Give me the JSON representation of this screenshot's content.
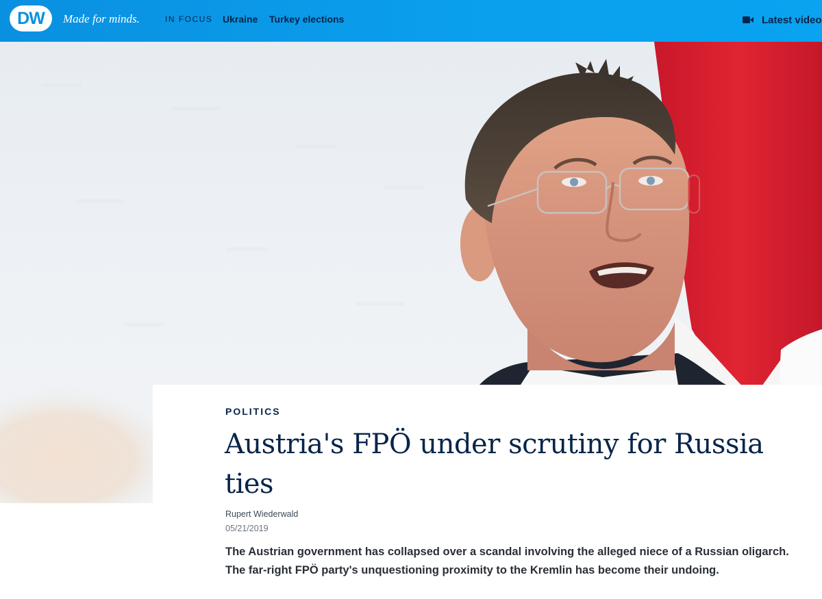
{
  "header": {
    "logo_text": "DW",
    "tagline": "Made for minds.",
    "in_focus_label": "IN FOCUS",
    "nav_links": [
      "Ukraine",
      "Turkey elections"
    ],
    "latest_label": "Latest video"
  },
  "hero": {
    "icon": "portrait-photo",
    "flag_colors": [
      "#d81e2c",
      "#ffffff"
    ]
  },
  "article": {
    "category": "POLITICS",
    "headline": "Austria's FPÖ under scrutiny for Russia ties",
    "author": "Rupert Wiederwald",
    "date": "05/21/2019",
    "teaser": "The Austrian government has collapsed over a scandal involving the alleged niece of a Russian oligarch. The far-right FPÖ party's unquestioning proximity to the Kremlin has become their undoing."
  },
  "colors": {
    "header_blue": "#0a90e0",
    "navy_text": "#07254a"
  }
}
